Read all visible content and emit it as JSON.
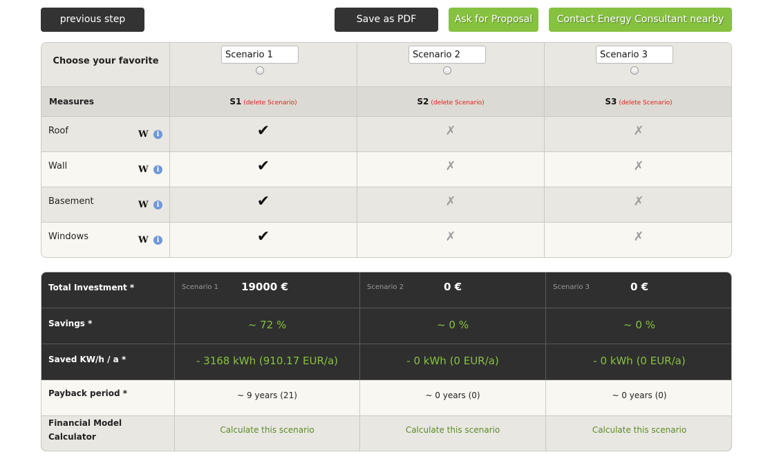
{
  "toolbar": {
    "previous_label": "previous step",
    "pdf_label": "Save as PDF",
    "proposal_label": "Ask for Proposal",
    "contact_label": "Contact  Energy  Consultant  nearby"
  },
  "colors": {
    "dark_button": "#333333",
    "green_button": "#86c140",
    "green_text": "#86c140",
    "delete_red": "#e0201b",
    "results_bg": "#2f2f2f"
  },
  "favorite": {
    "label": "Choose your favorite",
    "scenarios": [
      "Scenario 1",
      "Scenario 2",
      "Scenario 3"
    ]
  },
  "measures_header": {
    "label": "Measures",
    "columns": [
      "S1",
      "S2",
      "S3"
    ],
    "delete_label": "(delete Scenario)"
  },
  "measures": [
    {
      "name": "Roof",
      "marks": [
        "✔",
        "✗",
        "✗"
      ]
    },
    {
      "name": "Wall",
      "marks": [
        "✔",
        "✗",
        "✗"
      ]
    },
    {
      "name": "Basement",
      "marks": [
        "✔",
        "✗",
        "✗"
      ]
    },
    {
      "name": "Windows",
      "marks": [
        "✔",
        "✗",
        "✗"
      ]
    }
  ],
  "icons": {
    "wiki": "W",
    "info": "i"
  },
  "results": {
    "investment_label": "Total Investment *",
    "scenario_small": [
      "Scenario 1",
      "Scenario 2",
      "Scenario 3"
    ],
    "investment": [
      "19000 €",
      "0 €",
      "0 €"
    ],
    "savings_label": "Savings *",
    "savings": [
      "~ 72 %",
      "~ 0 %",
      "~ 0 %"
    ],
    "saved_label": "Saved KW/h / a *",
    "saved": [
      "- 3168 kWh (910.17 EUR/a)",
      "- 0 kWh (0 EUR/a)",
      "- 0 kWh (0 EUR/a)"
    ],
    "payback_label": "Payback period *",
    "payback": [
      "~ 9 years (21)",
      "~ 0 years (0)",
      "~ 0 years (0)"
    ],
    "financial_label": "Financial Model Calculator",
    "calc_label": "Calculate this scenario"
  }
}
